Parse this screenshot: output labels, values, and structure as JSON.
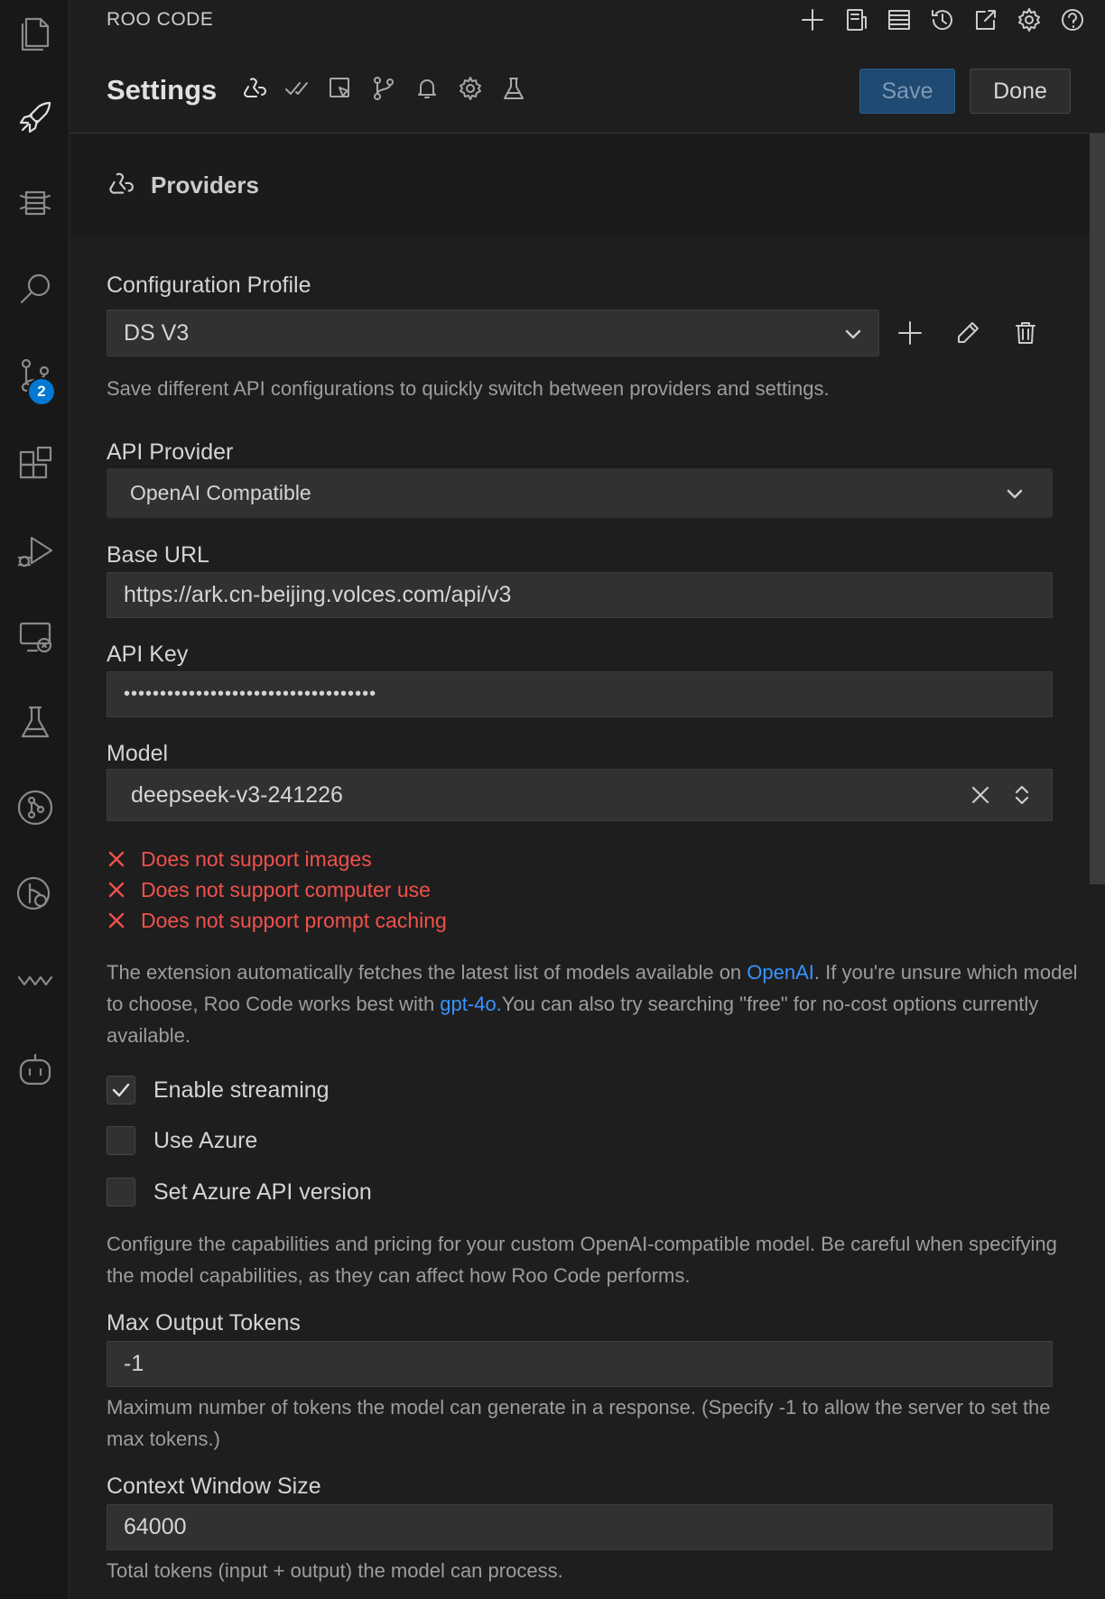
{
  "app": {
    "title": "ROO CODE"
  },
  "activity_bar": {
    "items": [
      {
        "icon": "files-icon"
      },
      {
        "icon": "rocket-icon"
      },
      {
        "icon": "extension-stack-icon"
      },
      {
        "icon": "search-icon"
      },
      {
        "icon": "source-control-icon",
        "badge": "2"
      },
      {
        "icon": "extensions-icon"
      },
      {
        "icon": "run-debug-icon"
      },
      {
        "icon": "remote-explorer-icon"
      },
      {
        "icon": "testing-icon"
      },
      {
        "icon": "git-graph-icon"
      },
      {
        "icon": "git-lens-icon"
      },
      {
        "icon": "wave-icon"
      },
      {
        "icon": "robot-icon"
      }
    ]
  },
  "top_actions": [
    "new-task-icon",
    "mcp-servers-icon",
    "prompts-icon",
    "history-icon",
    "popout-icon",
    "settings-icon",
    "help-icon"
  ],
  "settings": {
    "title": "Settings",
    "tabs": [
      "providers-icon",
      "auto-approve-icon",
      "browser-icon",
      "checkpoints-icon",
      "notifications-icon",
      "advanced-icon",
      "experimental-icon"
    ],
    "save_label": "Save",
    "done_label": "Done"
  },
  "section": {
    "title": "Providers"
  },
  "config_profile": {
    "label": "Configuration Profile",
    "value": "DS V3",
    "help": "Save different API configurations to quickly switch between providers and settings."
  },
  "api_provider": {
    "label": "API Provider",
    "value": "OpenAI Compatible"
  },
  "base_url": {
    "label": "Base URL",
    "value": "https://ark.cn-beijing.volces.com/api/v3"
  },
  "api_key": {
    "label": "API Key",
    "value": "•••••••••••••••••••••••••••••••••••"
  },
  "model": {
    "label": "Model",
    "value": "deepseek-v3-241226",
    "capabilities": [
      "Does not support images",
      "Does not support computer use",
      "Does not support prompt caching"
    ]
  },
  "model_help": {
    "part1": "The extension automatically fetches the latest list of models available on ",
    "link1": "OpenAI",
    "part2": ". If you're unsure which model to choose, Roo Code works best with ",
    "link2": "gpt-4o.",
    "part3": "You can also try searching \"free\" for no-cost options currently available."
  },
  "checkboxes": [
    {
      "label": "Enable streaming",
      "checked": true
    },
    {
      "label": "Use Azure",
      "checked": false
    },
    {
      "label": "Set Azure API version",
      "checked": false
    }
  ],
  "capabilities_help": "Configure the capabilities and pricing for your custom OpenAI-compatible model. Be careful when specifying the model capabilities, as they can affect how Roo Code performs.",
  "max_output_tokens": {
    "label": "Max Output Tokens",
    "value": "-1",
    "help": "Maximum number of tokens the model can generate in a response. (Specify -1 to allow the server to set the max tokens.)"
  },
  "context_window": {
    "label": "Context Window Size",
    "value": "64000",
    "help": "Total tokens (input + output) the model can process."
  }
}
